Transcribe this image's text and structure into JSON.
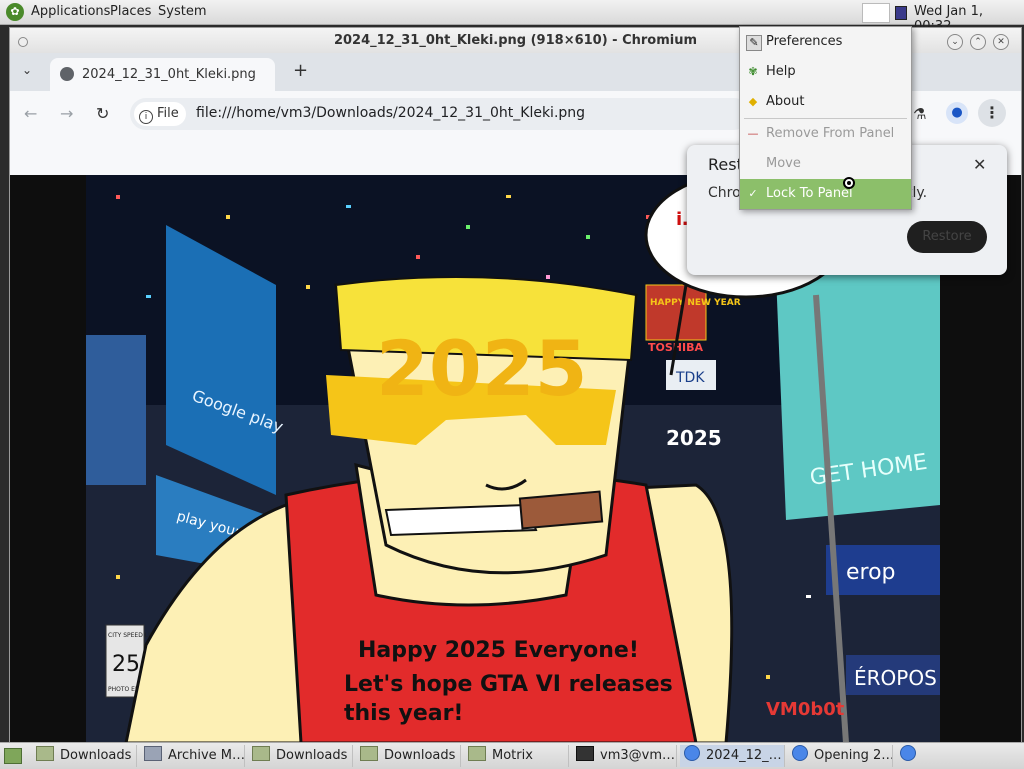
{
  "top_panel": {
    "menus": [
      "Applications",
      "Places",
      "System"
    ],
    "clock": "Wed Jan  1, 00:32"
  },
  "window": {
    "title": "2024_12_31_0ht_Kleki.png (918×610) - Chromium",
    "tab_title": "2024_12_31_0ht_Kleki.png",
    "url_chip": "File",
    "url": "file:///home/vm3/Downloads/2024_12_31_0ht_Kleki.png"
  },
  "restore_popup": {
    "title": "Rest",
    "text": "Chro",
    "text_tail": "ectly.",
    "button": "Restore"
  },
  "context_menu": {
    "items": [
      {
        "label": "Preferences",
        "icon": "preferences-icon",
        "enabled": true
      },
      {
        "label": "Help",
        "icon": "help-icon",
        "enabled": true
      },
      {
        "label": "About",
        "icon": "about-icon",
        "enabled": true
      },
      {
        "label": "Remove From Panel",
        "icon": "remove-icon",
        "enabled": false
      },
      {
        "label": "Move",
        "icon": "",
        "enabled": false
      },
      {
        "label": "Lock To Panel",
        "icon": "check-icon",
        "enabled": true,
        "checked": true
      }
    ]
  },
  "image": {
    "big_text": "2025",
    "caption_line1": "Happy 2025 Everyone!",
    "caption_line2": "Let's hope GTA VI releases",
    "caption_line3": "this year!",
    "watermark": "VM0b0t",
    "sign_google": "Google play",
    "sign_play": "play your",
    "sign_home": "GET HOME",
    "sign_tdk": "TDK",
    "sign_year": "2025",
    "sign_happy": "HAPPY NEW YEAR",
    "sign_toshiba": "TOSHIBA",
    "sign_speed_top": "CITY SPEED LIMIT",
    "sign_speed": "25",
    "sign_photo": "PHOTO ENFORCED",
    "sign_ero": "erop",
    "sign_aero": "ÉROPOS",
    "bubble_text": "i… a t"
  },
  "taskbar": {
    "items": [
      {
        "label": "Downloads",
        "icon": "folder-icon"
      },
      {
        "label": "Archive M…",
        "icon": "archive-icon"
      },
      {
        "label": "Downloads",
        "icon": "folder-icon"
      },
      {
        "label": "Downloads",
        "icon": "folder-icon"
      },
      {
        "label": "Motrix",
        "icon": "folder-icon"
      },
      {
        "label": "vm3@vm…",
        "icon": "terminal-icon"
      },
      {
        "label": "2024_12_…",
        "icon": "chromium-icon"
      },
      {
        "label": "Opening 2…",
        "icon": "chromium-icon"
      }
    ]
  },
  "colors": {
    "accent_green": "#8cbf6a",
    "caption_red": "#e53935",
    "text_yellow": "#f5c518"
  }
}
